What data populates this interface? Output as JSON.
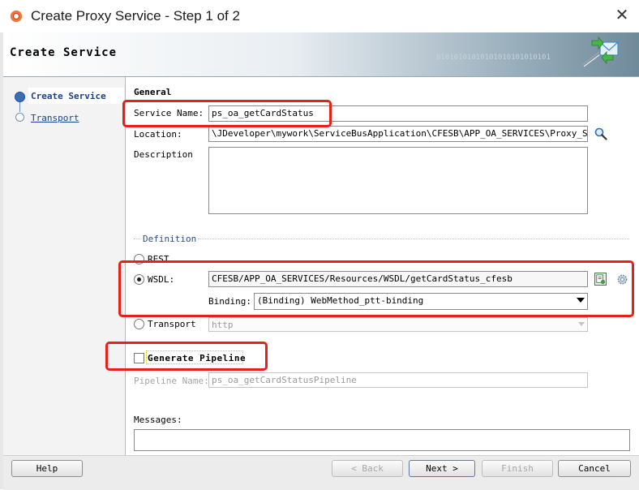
{
  "window": {
    "title": "Create Proxy Service - Step 1 of 2",
    "close_glyph": "✕"
  },
  "banner": {
    "title": "Create Service",
    "binary_text": "01010101010101010101010101",
    "icon": "wsdl-envelope-icon"
  },
  "steps": [
    {
      "label": "Create Service",
      "active": true
    },
    {
      "label": "Transport",
      "active": false
    }
  ],
  "general": {
    "heading": "General",
    "service_name_label": "Service Name:",
    "service_name_value": "ps_oa_getCardStatus",
    "location_label": "Location:",
    "location_value": "\\JDeveloper\\mywork\\ServiceBusApplication\\CFESB\\APP_OA_SERVICES\\Proxy_Services",
    "description_label": "Description",
    "description_value": ""
  },
  "definition": {
    "title": "Definition",
    "rest_label": "REST",
    "wsdl_label": "WSDL:",
    "wsdl_value": "CFESB/APP_OA_SERVICES/Resources/WSDL/getCardStatus_cfesb",
    "binding_label": "Binding:",
    "binding_value": "(Binding) WebMethod_ptt-binding",
    "transport_label": "Transport",
    "transport_value": "http",
    "selected": "WSDL"
  },
  "pipeline": {
    "generate_label": "Generate Pipeline",
    "generate_checked": false,
    "name_label": "Pipeline Name:",
    "name_value": "ps_oa_getCardStatusPipeline"
  },
  "messages": {
    "label": "Messages:",
    "value": ""
  },
  "buttons": {
    "help": "Help",
    "back": "< Back",
    "next": "Next >",
    "finish": "Finish",
    "cancel": "Cancel"
  },
  "colors": {
    "annotation_red": "#e8201a",
    "step_blue": "#1c3f8a"
  }
}
